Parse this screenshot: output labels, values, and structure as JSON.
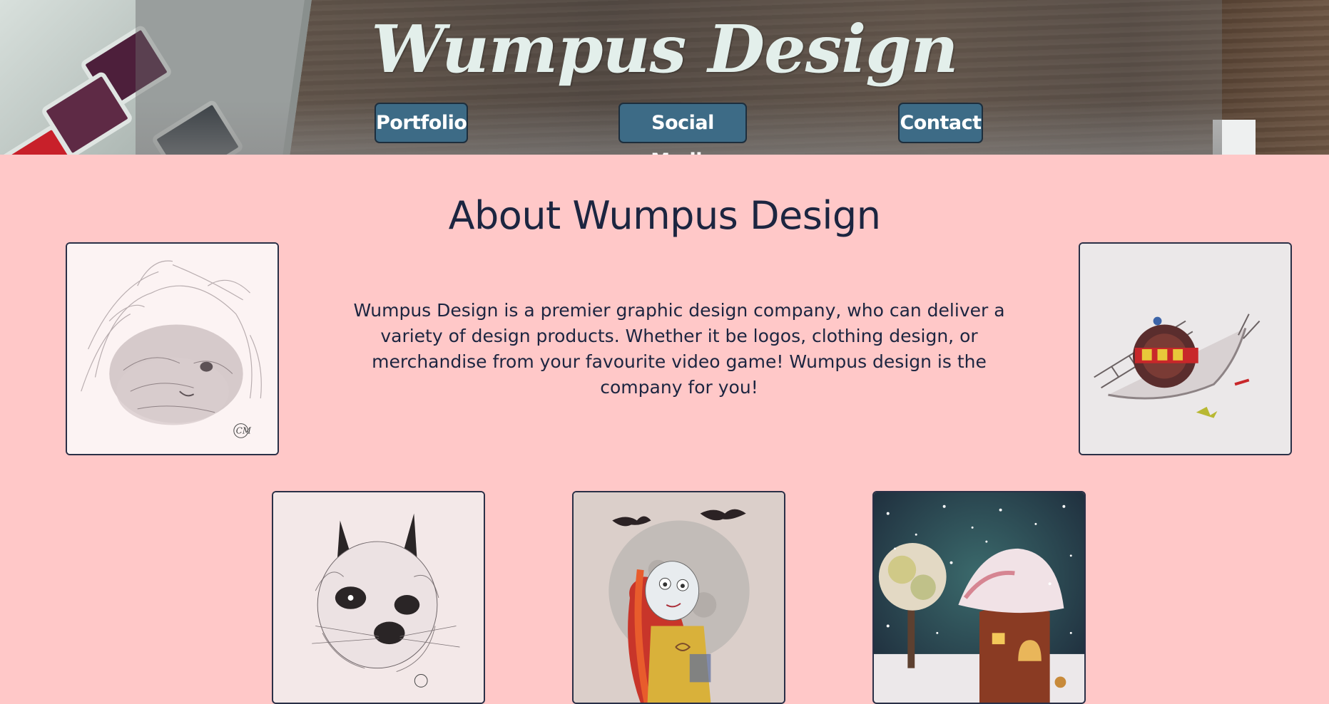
{
  "header": {
    "brand": "Wumpus Design",
    "nav": [
      {
        "label": "Portfolio"
      },
      {
        "label": "Social Media"
      },
      {
        "label": "Contact"
      }
    ]
  },
  "about": {
    "title": "About Wumpus Design",
    "text": "Wumpus Design is a premier graphic design company, who can deliver a variety of design products. Whether it be logos, clothing design, or merchandise from your favourite video game! Wumpus design is the company for you!"
  },
  "gallery": [
    {
      "name": "guinea-pig-drawing",
      "icon": "fluffy-guinea-pig-artwork"
    },
    {
      "name": "snail-drawing",
      "icon": "snail-with-ladder-artwork"
    },
    {
      "name": "rabbit-drawing",
      "icon": "bunny-artwork"
    },
    {
      "name": "sally-drawing",
      "icon": "sally-moon-bats-artwork"
    },
    {
      "name": "snow-house-drawing",
      "icon": "mushroom-house-snow-artwork"
    }
  ],
  "colors": {
    "page_background": "#ffc8c8",
    "nav_button": "#3d6b86",
    "heading_text": "#1c2540",
    "brand_text": "#e3efeb"
  }
}
